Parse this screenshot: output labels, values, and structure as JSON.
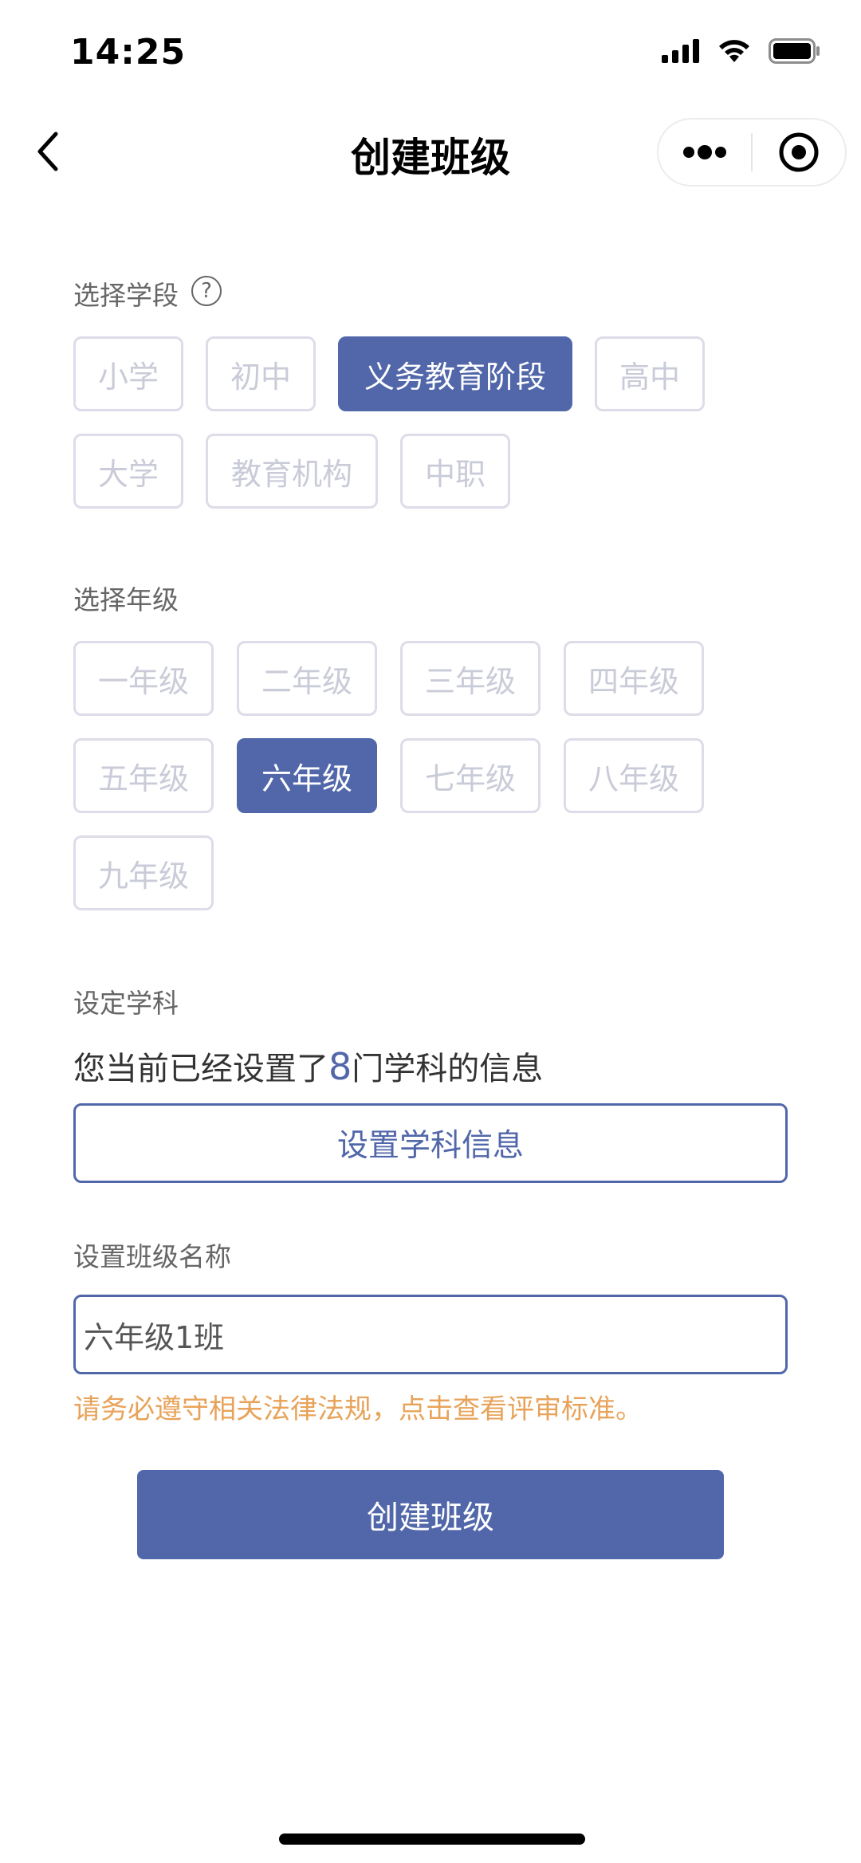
{
  "status_bar": {
    "time": "14:25"
  },
  "nav": {
    "title": "创建班级",
    "back_icon": "chevron-left-icon",
    "more_icon": "more-dots-icon",
    "close_icon": "target-circle-icon"
  },
  "stage": {
    "label": "选择学段",
    "help_glyph": "?",
    "options": [
      "小学",
      "初中",
      "义务教育阶段",
      "高中",
      "大学",
      "教育机构",
      "中职"
    ],
    "selected": "义务教育阶段"
  },
  "grade": {
    "label": "选择年级",
    "options": [
      "一年级",
      "二年级",
      "三年级",
      "四年级",
      "五年级",
      "六年级",
      "七年级",
      "八年级",
      "九年级"
    ],
    "selected": "六年级"
  },
  "subject": {
    "label": "设定学科",
    "info_prefix": "您当前已经设置了",
    "count": "8",
    "info_suffix": "门学科的信息",
    "button_label": "设置学科信息"
  },
  "class_name": {
    "label": "设置班级名称",
    "value": "六年级1班",
    "warning": "请务必遵守相关法律法规，点击查看评审标准。"
  },
  "submit": {
    "label": "创建班级"
  },
  "colors": {
    "accent": "#5167aa",
    "chip_border": "#dcdde8",
    "chip_text": "#c9cbd8",
    "warning": "#e8a35a"
  }
}
